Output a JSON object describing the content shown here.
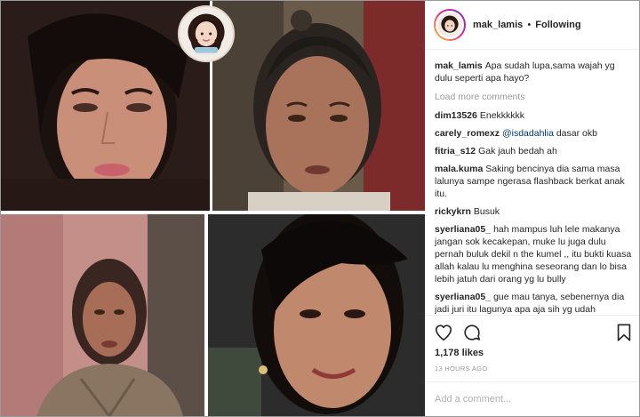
{
  "post": {
    "username": "mak_lamis",
    "separator": "•",
    "follow_status": "Following",
    "logo_text": "mak_lamis"
  },
  "caption": {
    "username": "mak_lamis",
    "text": "Apa sudah lupa,sama wajah yg dulu seperti apa hayo?"
  },
  "load_more": "Load more comments",
  "comments": [
    {
      "username": "dim13526",
      "text": "Enekkkkkk"
    },
    {
      "username": "carely_romexz",
      "mention": "@isdadahlia",
      "text": "dasar okb"
    },
    {
      "username": "fitria_s12",
      "text": "Gak jauh bedah ah"
    },
    {
      "username": "mala.kuma",
      "text": "Saking bencinya dia sama masa lalunya sampe ngerasa flashback berkat anak itu."
    },
    {
      "username": "rickykrn",
      "text": "Busuk"
    },
    {
      "username": "syerliana05_",
      "text": "hah mampus luh lele makanya jangan sok kecakepan, muke lu juga dulu pernah buluk dekil n the kumel ,, itu bukti kuasa allah kalau lu menghina seseorang dan lo bisa lebih jatuh dari orang yg lu bully"
    },
    {
      "username": "syerliana05_",
      "text": "gue mau tanya, sebenernya dia jadi juri itu lagunya apa aja sih yg udah"
    }
  ],
  "likes": "1,178 likes",
  "timestamp": "13 HOURS AGO",
  "add_comment_placeholder": "Add a comment...",
  "icons": {
    "like": "heart-icon",
    "comment": "comment-icon",
    "save": "bookmark-icon"
  },
  "colors": {
    "text": "#262626",
    "muted": "#999999",
    "mention": "#003569",
    "border": "#efefef"
  }
}
